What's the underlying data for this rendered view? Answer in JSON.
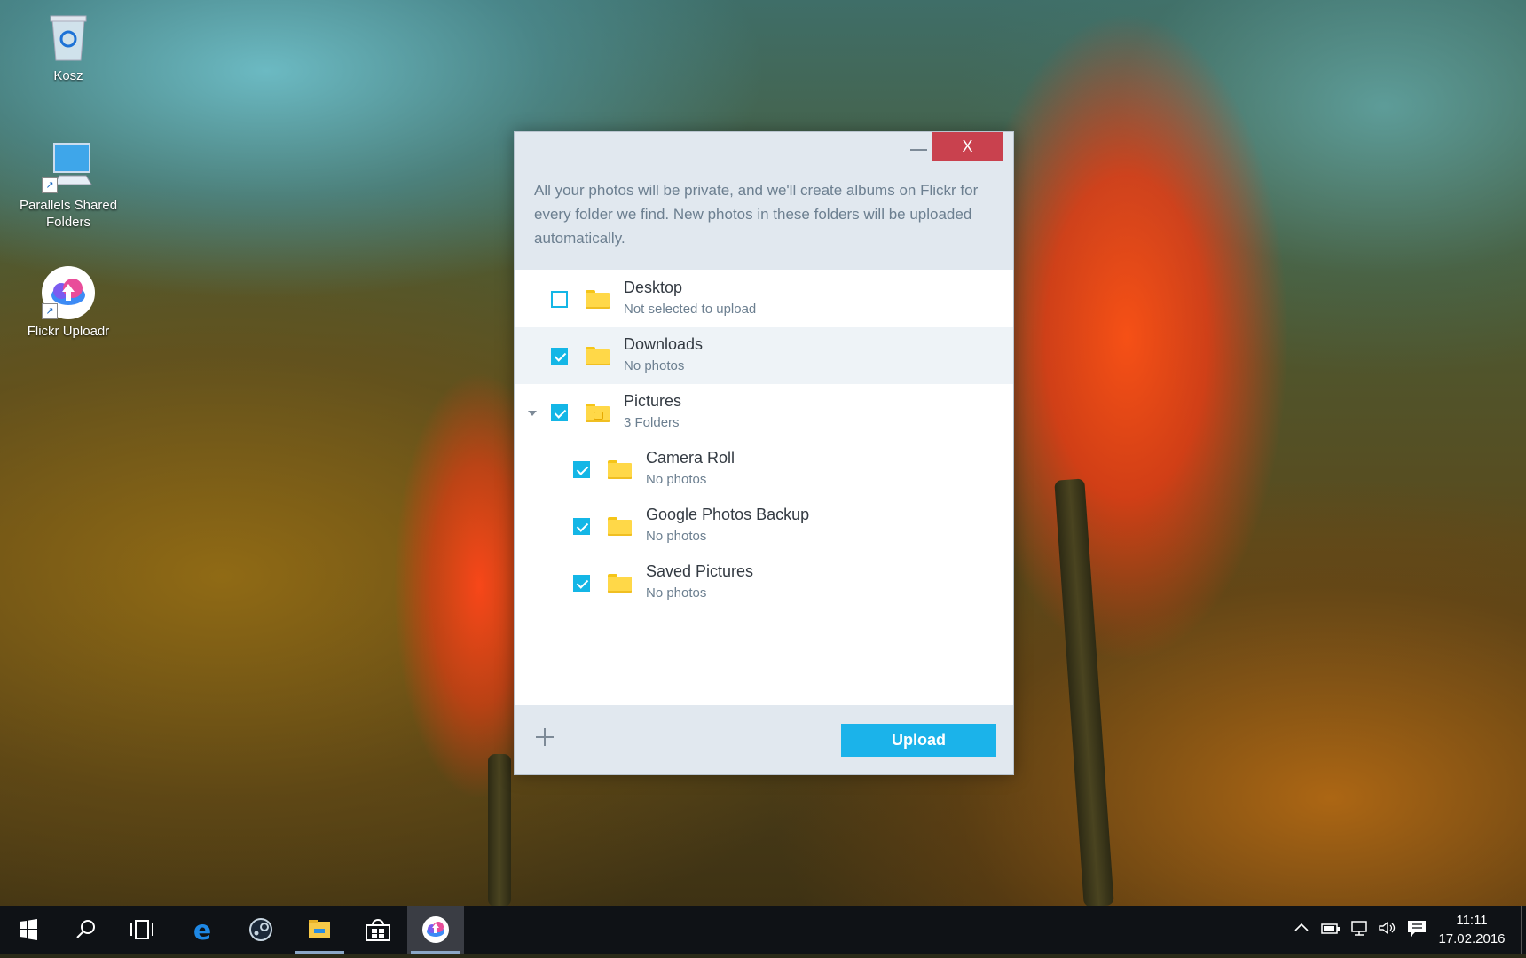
{
  "desktop": {
    "icons": [
      {
        "label": "Kosz"
      },
      {
        "label": "Parallels Shared Folders"
      },
      {
        "label": "Flickr Uploadr"
      }
    ]
  },
  "dialog": {
    "close_label": "X",
    "description": "All your photos will be private, and we'll create albums on Flickr for every folder we find. New photos in these folders will be uploaded automatically.",
    "folders": [
      {
        "name": "Desktop",
        "status": "Not selected to upload",
        "checked": false
      },
      {
        "name": "Downloads",
        "status": "No photos",
        "checked": true
      },
      {
        "name": "Pictures",
        "status": "3 Folders",
        "checked": true,
        "expanded": true
      },
      {
        "name": "Camera Roll",
        "status": "No photos",
        "checked": true
      },
      {
        "name": "Google Photos Backup",
        "status": "No photos",
        "checked": true
      },
      {
        "name": "Saved Pictures",
        "status": "No photos",
        "checked": true
      }
    ],
    "upload_label": "Upload"
  },
  "taskbar": {
    "apps": [
      "start-icon",
      "search-icon",
      "task-view-icon",
      "edge-icon",
      "steam-icon",
      "file-explorer-icon",
      "store-icon",
      "flickr-uploadr-icon"
    ],
    "clock": {
      "time": "11:11",
      "date": "17.02.2016"
    }
  },
  "colors": {
    "accent": "#1bb3ea",
    "close": "#c9414e",
    "header": "#e1e8ef"
  }
}
